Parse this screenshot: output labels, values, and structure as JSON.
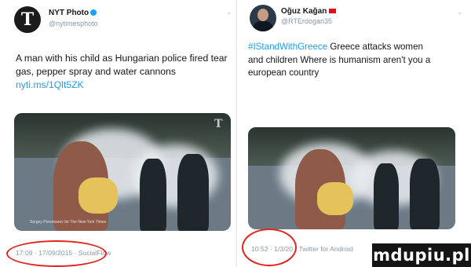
{
  "left_tweet": {
    "display_name": "NYT Photo",
    "handle": "@nytimesphoto",
    "avatar_letter": "T",
    "text_plain": "A man with his child as Hungarian police fired tear gas, pepper spray and water cannons ",
    "text_link": "nyti.ms/1Qlt5ZK",
    "photo_caption": "Sergey Ponomarev for The New York Times",
    "photo_logo": "T",
    "timestamp": "17:09 · 17/09/2015 · ",
    "source": "SocialFlow"
  },
  "right_tweet": {
    "display_name": "Oğuz Kağan",
    "handle": "@RTErdogan35",
    "hashtag": "#IStandWithGreece",
    "text_plain": " Greece attacks women and children Where is humanism aren't you a european country",
    "timestamp": "10:52 · 1/3/20 · ",
    "source": "Twitter for Android"
  },
  "watermark": {
    "text": "mdupiu.pl"
  },
  "colors": {
    "link": "#1da1f2",
    "muted": "#8899a6",
    "annotation_circle": "#e2241b",
    "watermark_bg": "#151515"
  },
  "icons": [
    "verified-badge-icon",
    "chevron-down-icon",
    "turkish-flag-icon"
  ]
}
